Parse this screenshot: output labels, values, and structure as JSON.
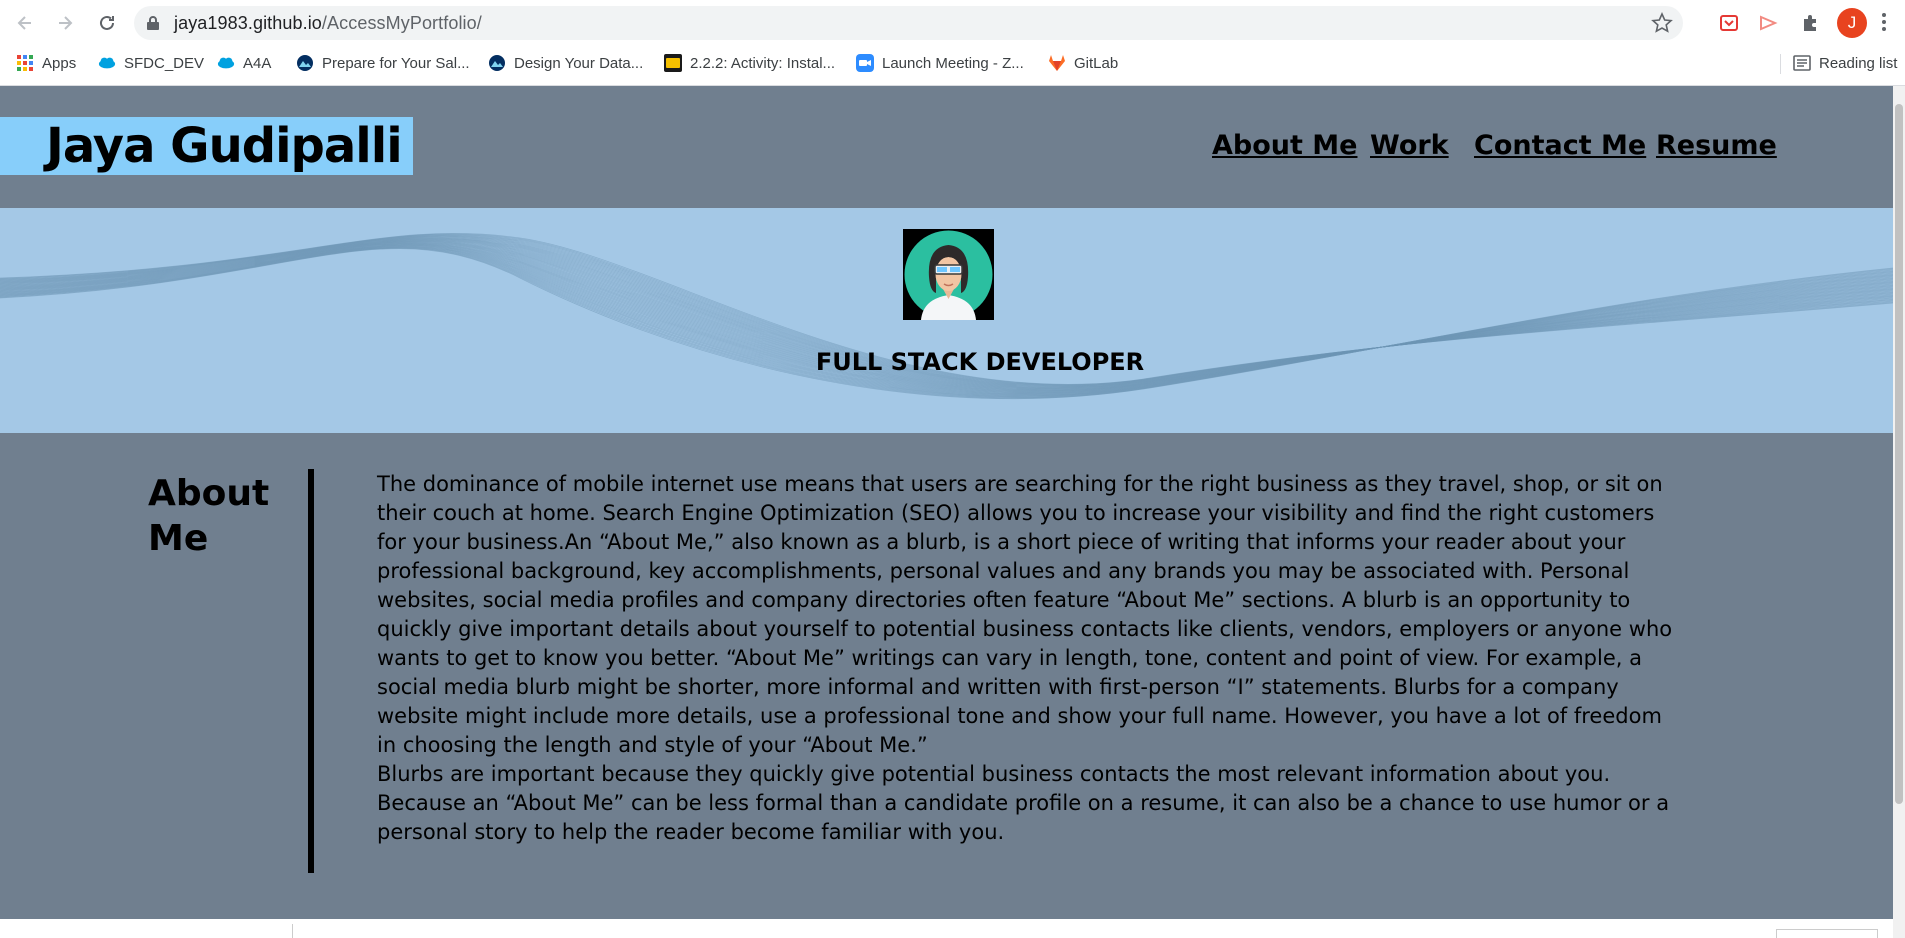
{
  "browser": {
    "url_host": "jaya1983.github.io",
    "url_path": "/AccessMyPortfolio/",
    "profile_initial": "J",
    "bookmarks": [
      {
        "label": "Apps",
        "icon": "apps-grid-icon"
      },
      {
        "label": "SFDC_DEV",
        "icon": "salesforce-cloud-icon"
      },
      {
        "label": "A4A",
        "icon": "salesforce-cloud-icon"
      },
      {
        "label": "Prepare for Your Sal...",
        "icon": "trailhead-icon"
      },
      {
        "label": "Design Your Data...",
        "icon": "trailhead-icon"
      },
      {
        "label": "2.2.2: Activity: Instal...",
        "icon": "bootcamp-icon"
      },
      {
        "label": "Launch Meeting - Z...",
        "icon": "zoom-icon"
      },
      {
        "label": "GitLab",
        "icon": "gitlab-icon"
      }
    ],
    "reading_list": "Reading list"
  },
  "site": {
    "brand": "Jaya Gudipalli",
    "nav": [
      "About Me",
      "Work",
      "Contact Me",
      "Resume"
    ],
    "hero_title": "FULL STACK DEVELOPER",
    "about_heading_line1": "About",
    "about_heading_line2": "Me",
    "about_paragraph_1": "The dominance of mobile internet use means that users are searching for the right business as they travel, shop, or sit on their couch at home. Search Engine Optimization (SEO) allows you to increase your visibility and find the right customers for your business.An “About Me,” also known as a blurb, is a short piece of writing that informs your reader about your professional background, key accomplishments, personal values and any brands you may be associated with. Personal websites, social media profiles and company directories often feature “About Me” sections. A blurb is an opportunity to quickly give important details about yourself to potential business contacts like clients, vendors, employers or anyone who wants to get to know you better. “About Me” writings can vary in length, tone, content and point of view. For example, a social media blurb might be shorter, more informal and written with first-person “I” statements. Blurbs for a company website might include more details, use a professional tone and show your full name. However, you have a lot of freedom in choosing the length and style of your “About Me.”",
    "about_paragraph_2": "Blurbs are important because they quickly give potential business contacts the most relevant information about you. Because an “About Me” can be less formal than a candidate profile on a resume, it can also be a chance to use humor or a personal story to help the reader become familiar with you."
  },
  "colors": {
    "header_bg": "#707f8f",
    "brand_bg": "#87cefa",
    "hero_bg": "#a4c8e6",
    "profile": "#e8431f"
  }
}
